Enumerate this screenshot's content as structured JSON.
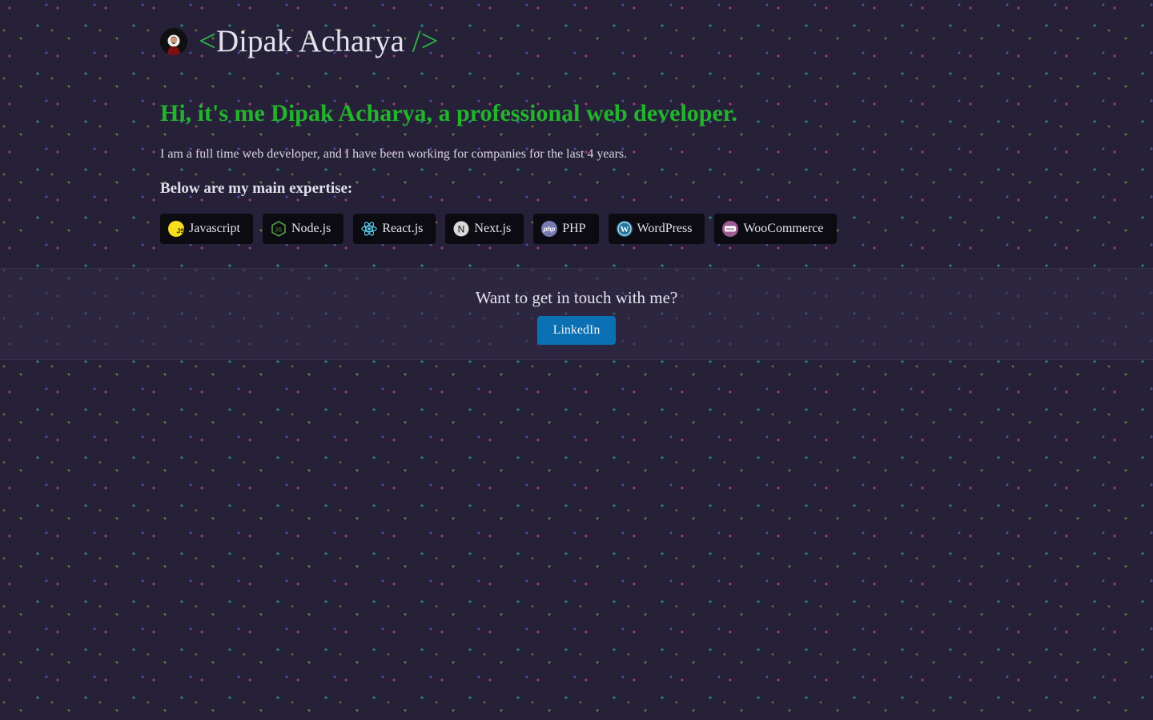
{
  "header": {
    "brand_open": "<",
    "brand_name": "Dipak Acharya",
    "brand_close": " />"
  },
  "hero": {
    "headline": "Hi, it's me Dipak Acharya, a professional web developer.",
    "intro": "I am a full time web developer, and I have been working for companies for the last 4 years.",
    "expertise_heading": "Below are my main expertise:"
  },
  "skills": [
    {
      "label": "Javascript",
      "icon": "javascript-icon"
    },
    {
      "label": "Node.js",
      "icon": "nodejs-icon"
    },
    {
      "label": "React.js",
      "icon": "react-icon"
    },
    {
      "label": "Next.js",
      "icon": "nextjs-icon"
    },
    {
      "label": "PHP",
      "icon": "php-icon"
    },
    {
      "label": "WordPress",
      "icon": "wordpress-icon"
    },
    {
      "label": "WooCommerce",
      "icon": "woocommerce-icon"
    }
  ],
  "contact": {
    "question": "Want to get in touch with me?",
    "linkedin_label": "LinkedIn"
  },
  "colors": {
    "background": "#262139",
    "accent_green": "#22b52b",
    "linkedin_blue": "#0a6fb3",
    "chip_background": "#0c0b12"
  }
}
